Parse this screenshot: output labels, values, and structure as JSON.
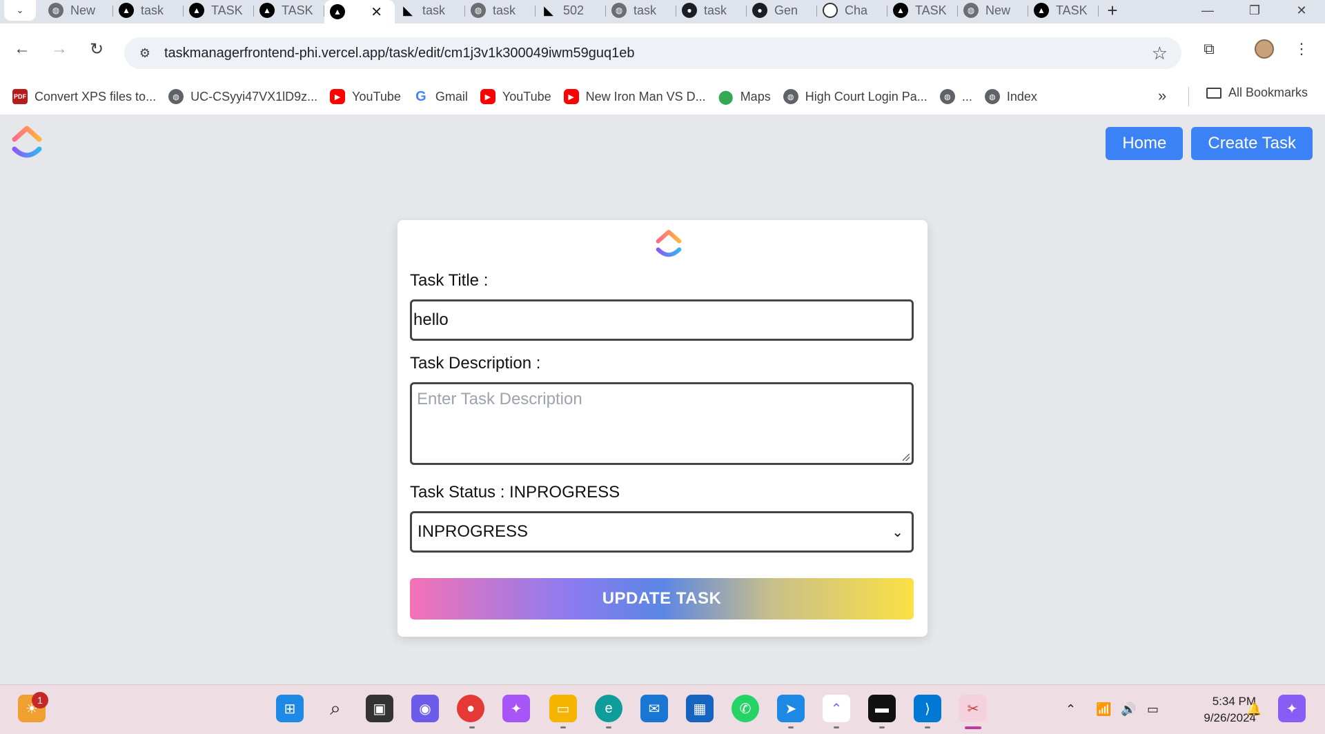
{
  "browser": {
    "tabs": [
      {
        "label": "New",
        "icon": "chrome-icon"
      },
      {
        "label": "task",
        "icon": "triangle-icon"
      },
      {
        "label": "TASK",
        "icon": "triangle-icon"
      },
      {
        "label": "TASK",
        "icon": "triangle-icon"
      },
      {
        "label": "",
        "icon": "triangle-icon",
        "active": true
      },
      {
        "label": "task",
        "icon": "render-icon"
      },
      {
        "label": "task",
        "icon": "globe-icon"
      },
      {
        "label": "502",
        "icon": "render-icon"
      },
      {
        "label": "task",
        "icon": "globe-icon"
      },
      {
        "label": "task",
        "icon": "github-icon"
      },
      {
        "label": "Gen",
        "icon": "github-icon"
      },
      {
        "label": "Cha",
        "icon": "chatgpt-icon"
      },
      {
        "label": "TASK",
        "icon": "triangle-icon"
      },
      {
        "label": "New",
        "icon": "chrome-icon"
      },
      {
        "label": "TASK",
        "icon": "triangle-icon"
      }
    ],
    "url": "taskmanagerfrontend-phi.vercel.app/task/edit/cm1j3v1k300049iwm59guq1eb"
  },
  "bookmarks": {
    "items": [
      {
        "label": "Convert XPS files to...",
        "icon": "pdf"
      },
      {
        "label": "UC-CSyyi47VX1lD9z...",
        "icon": "globe"
      },
      {
        "label": "YouTube",
        "icon": "yt"
      },
      {
        "label": "Gmail",
        "icon": "g"
      },
      {
        "label": "YouTube",
        "icon": "yt"
      },
      {
        "label": "New Iron Man VS D...",
        "icon": "yt"
      },
      {
        "label": "Maps",
        "icon": "maps"
      },
      {
        "label": "High Court Login Pa...",
        "icon": "globe"
      },
      {
        "label": "...",
        "icon": "globe"
      },
      {
        "label": "Index",
        "icon": "globe"
      }
    ],
    "all_bookmarks": "All Bookmarks"
  },
  "app": {
    "nav": {
      "home": "Home",
      "create": "Create Task"
    },
    "form": {
      "title_label": "Task Title :",
      "title_value": "hello",
      "description_label": "Task Description :",
      "description_placeholder": "Enter Task Description",
      "status_label": "Task Status : INPROGRESS",
      "status_value": "INPROGRESS",
      "submit": "UPDATE TASK"
    }
  },
  "taskbar": {
    "notification_badge": "1",
    "time": "5:34 PM",
    "date": "9/26/2024"
  },
  "colors": {
    "primary_button": "#3b82f6",
    "page_bg": "#e5e7eb",
    "gradient_start": "#f472b6",
    "gradient_mid": "#5b86e5",
    "gradient_end": "#fbe044"
  }
}
